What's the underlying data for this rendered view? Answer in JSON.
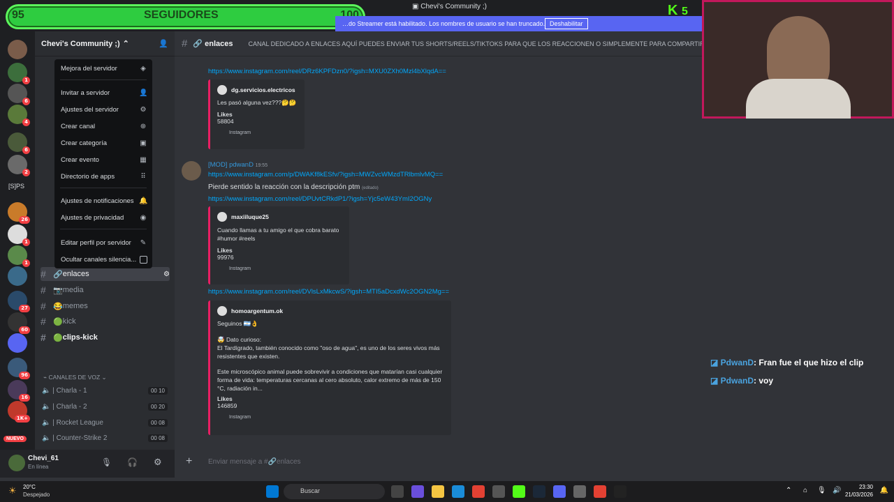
{
  "follow_widget": {
    "count_left": "95",
    "label": "SEGUIDORES",
    "count_right": "100"
  },
  "window_title": "Chevi's Community ;)",
  "banner": {
    "text": "…do Streamer está habilitado. Los nombres de usuario se han truncado.",
    "button": "Deshabilitar"
  },
  "kick_badge": {
    "letter": "K",
    "count": "5"
  },
  "server": {
    "name": "Chevi's Community ;)"
  },
  "server_list": {
    "label_sps": "[S]PS",
    "badges": [
      "1",
      "6",
      "4",
      "6",
      "2",
      "26",
      "1",
      "1",
      "27",
      "60",
      "96",
      "16",
      "1K+"
    ],
    "new_label": "NUEVO"
  },
  "menu": {
    "items": [
      "Mejora del servidor",
      "Invitar a servidor",
      "Ajustes del servidor",
      "Crear canal",
      "Crear categoría",
      "Crear evento",
      "Directorio de apps",
      "Ajustes de notificaciones",
      "Ajustes de privacidad",
      "Editar perfil por servidor",
      "Ocultar canales silencia..."
    ]
  },
  "channels": [
    {
      "emoji": "🔗",
      "name": "enlaces"
    },
    {
      "emoji": "📷",
      "name": "media"
    },
    {
      "emoji": "😂",
      "name": "memes"
    },
    {
      "emoji": "🟢",
      "name": "kick"
    },
    {
      "emoji": "🟢",
      "name": "clips-kick"
    }
  ],
  "voice": {
    "category": "CANALES DE VOZ",
    "channels": [
      {
        "name": "| Charla - 1",
        "a": "00",
        "b": "10"
      },
      {
        "name": "| Charla - 2",
        "a": "00",
        "b": "20"
      },
      {
        "name": "| Rocket League",
        "a": "00",
        "b": "08"
      },
      {
        "name": "| Counter-Strike 2",
        "a": "00",
        "b": "08"
      }
    ]
  },
  "user": {
    "name": "Chevi_61",
    "status": "En línea"
  },
  "topbar": {
    "channel": "enlaces",
    "topic": "CANAL DEDICADO A ENLACES AQUÍ PUEDES ENVIAR TUS SHORTS/REELS/TIKTOKS PARA QUE LOS REACCIONEN O SIMPLEMENTE PARA COMPARTIR CO..."
  },
  "messages": {
    "link1": "https://www.instagram.com/reel/DRz6KPFDzn0/?igsh=MXU0ZXh0Mzl4bXlqdA==",
    "embed1": {
      "author": "dg.servicios.electricos",
      "text": "Les pasó alguna vez???🤔🤔",
      "likes_label": "Likes",
      "likes": "58804",
      "footer": "Instagram"
    },
    "author2": "[MOD] pdwanD",
    "time2": "19:55",
    "link2": "https://www.instagram.com/p/DWAKf8kESfv/?igsh=MWZvcWMzdTRlbmlvMQ==",
    "text2": "Pierde sentido la reacción con la descripción ptm",
    "edited": "(editado)",
    "link3": "https://www.instagram.com/reel/DPUvtCRkdP1/?igsh=Yjc5eW43YmI2OGNy",
    "embed2": {
      "author": "maxiiluque25",
      "text": "Cuando llamas a tu amigo el que cobra barato #humor #reels",
      "likes_label": "Likes",
      "likes": "99976",
      "footer": "Instagram"
    },
    "link4": "https://www.instagram.com/reel/DVlsLxMkcwS/?igsh=MTI5aDcxdWc2OGN2Mg==",
    "embed3": {
      "author": "homoargentum.ok",
      "line1": "Seguinos 🇦🇷👌",
      "line2": "🤯 Dato curioso:",
      "line3": "El Tardígrado, también conocido como \"oso de agua\", es uno de los seres vivos más resistentes que existen.",
      "line4": "Este microscópico animal puede sobrevivir a condiciones que matarían casi cualquier forma de vida: temperaturas cercanas al cero absoluto, calor extremo de más de 150 °C, radiación in...",
      "likes_label": "Likes",
      "likes": "146859",
      "footer": "Instagram"
    }
  },
  "input": {
    "placeholder": "Enviar mensaje a #🔗enlaces"
  },
  "overlay_chat": [
    {
      "user": "PdwanD",
      "text": ": Fran fue el que hizo el clip"
    },
    {
      "user": "PdwanD",
      "text": ": voy"
    }
  ],
  "taskbar": {
    "weather_temp": "20°C",
    "weather_desc": "Despejado",
    "search": "Buscar",
    "time": "23:30",
    "date": "21/03/2026"
  },
  "colors": {
    "follow_green": "#2ecc40",
    "accent": "#5865f2",
    "link": "#00a8fc",
    "embed_bar": "#e91e63"
  }
}
